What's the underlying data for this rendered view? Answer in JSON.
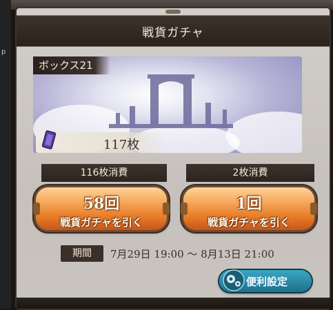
{
  "side_glyph": "p",
  "panel": {
    "title": "戦貨ガチャ"
  },
  "box": {
    "label": "ボックス21",
    "ticket_count": "117枚"
  },
  "draws": [
    {
      "cost": "116枚消費",
      "count": "58回",
      "label": "戦貨ガチャを引く"
    },
    {
      "cost": "2枚消費",
      "count": "1回",
      "label": "戦貨ガチャを引く"
    }
  ],
  "period": {
    "tag": "期間",
    "text": "7月29日 19:00 ～ 8月13日 21:00"
  },
  "settings": {
    "label": "便利設定",
    "icon": "gear-icon"
  },
  "colors": {
    "button_orange": "#e67b25",
    "settings_teal": "#1f6f8a",
    "dark_label": "#3a302a"
  }
}
